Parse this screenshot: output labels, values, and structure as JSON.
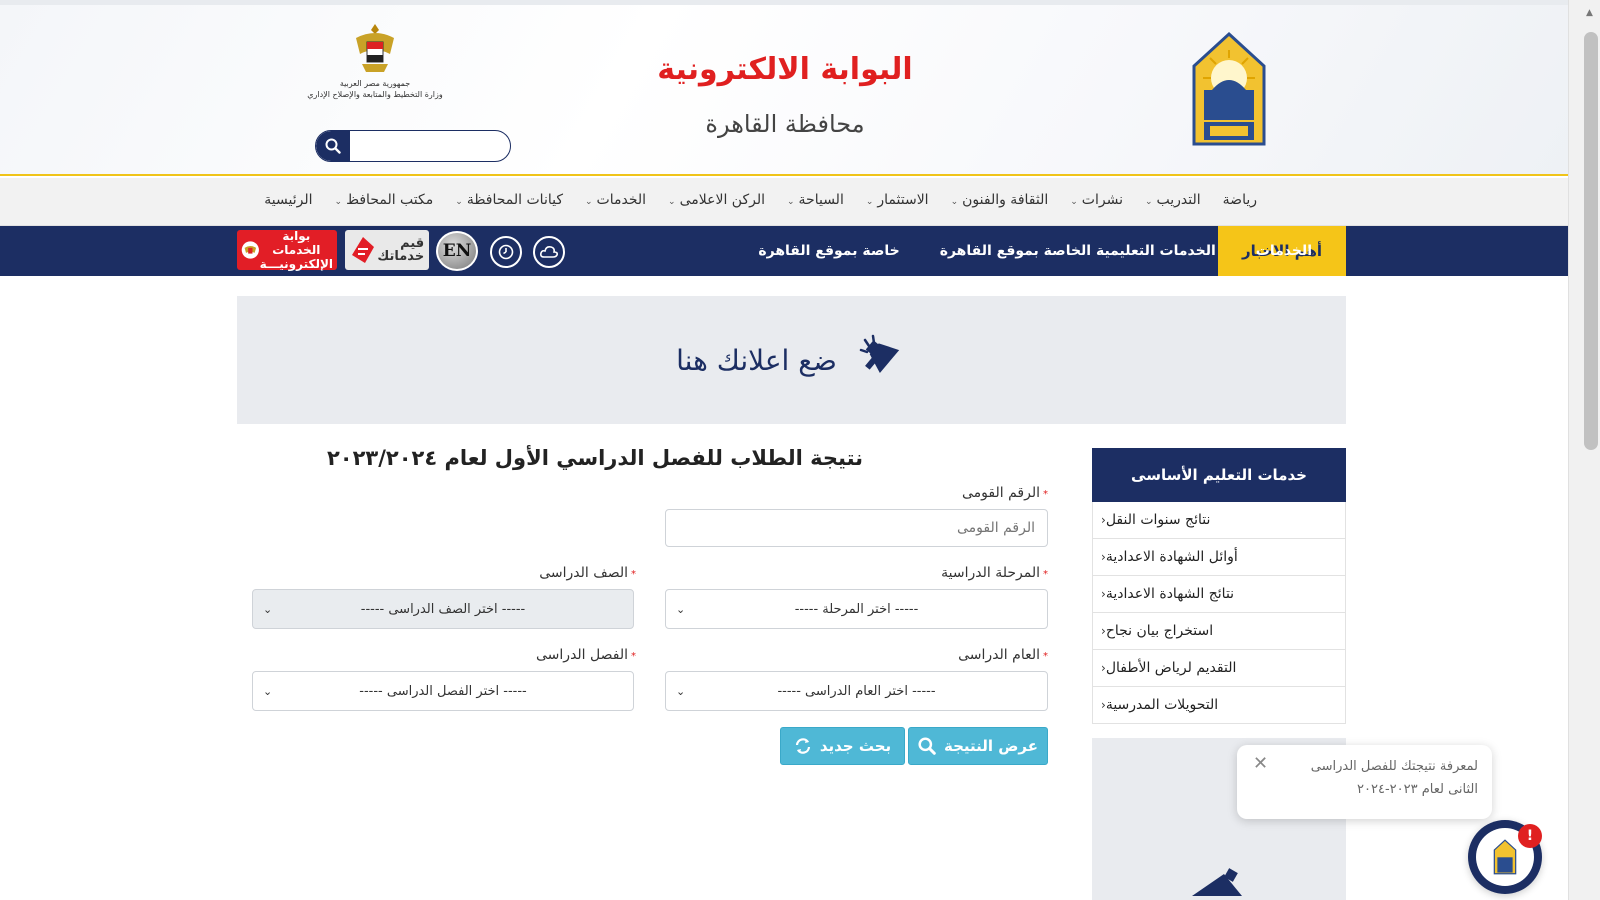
{
  "header": {
    "title": "البوابة الالكترونية",
    "subtitle": "محافظة القاهرة",
    "ministry_line1": "جمهورية مصر العربية",
    "ministry_line2": "وزارة التخطيط والمتابعة والإصلاح الإداري",
    "search_placeholder": ""
  },
  "mainnav": [
    {
      "label": "الرئيسية",
      "dropdown": false
    },
    {
      "label": "مكتب المحافظ",
      "dropdown": true
    },
    {
      "label": "كيانات المحافظة",
      "dropdown": true
    },
    {
      "label": "الخدمات",
      "dropdown": true
    },
    {
      "label": "الركن الاعلامى",
      "dropdown": true
    },
    {
      "label": "السياحة",
      "dropdown": true
    },
    {
      "label": "الاستثمار",
      "dropdown": true
    },
    {
      "label": "الثقافة والفنون",
      "dropdown": true
    },
    {
      "label": "نشرات",
      "dropdown": true
    },
    {
      "label": "التدريب",
      "dropdown": true
    },
    {
      "label": "رياضة",
      "dropdown": false
    }
  ],
  "bluebar": {
    "news": "أهم الاخبار",
    "links": [
      "خاصة بموقع القاهرة",
      "الخدمات التعليمية الخاصة بموقع القاهرة",
      "الخدمات"
    ],
    "en": "EN",
    "qiyam_line1": "قيم",
    "qiyam_line2": "خدماتك",
    "egov_line1": "بوابة الخدمات",
    "egov_line2": "الإلكترونيـــة"
  },
  "ad": {
    "text": "ضع اعلانك هنا"
  },
  "sidebar": {
    "title": "خدمات التعليم الأساسى",
    "items": [
      "نتائج سنوات النقل",
      "أوائل الشهادة الاعدادية",
      "نتائج الشهادة الاعدادية",
      "استخراج بيان نجاح",
      "التقديم لرياض الأطفال",
      "التحويلات المدرسية"
    ]
  },
  "form": {
    "title": "نتيجة الطلاب للفصل الدراسي الأول لعام ٢٠٢٣/٢٠٢٤",
    "national_id_label": "الرقم القومى",
    "national_id_placeholder": "الرقم القومى",
    "stage_label": "المرحلة الدراسية",
    "stage_value": "----- اختر المرحلة -----",
    "grade_label": "الصف الدراسى",
    "grade_value": "----- اختر الصف الدراسى -----",
    "year_label": "العام الدراسى",
    "year_value": "----- اختر العام الدراسى -----",
    "term_label": "الفصل الدراسى",
    "term_value": "----- اختر الفصل الدراسى -----",
    "required_mark": "*",
    "show_result": "عرض النتيجة",
    "new_search": "بحث جديد"
  },
  "toast": {
    "line1": "لمعرفة نتيجتك للفصل الدراسى",
    "line2": "الثانى لعام ٢٠٢٣-٢٠٢٤"
  },
  "chat": {
    "badge": "!"
  },
  "colors": {
    "navy": "#1c2e63",
    "yellow": "#f5c518",
    "red": "#e02020",
    "button": "#4fb8d6"
  }
}
